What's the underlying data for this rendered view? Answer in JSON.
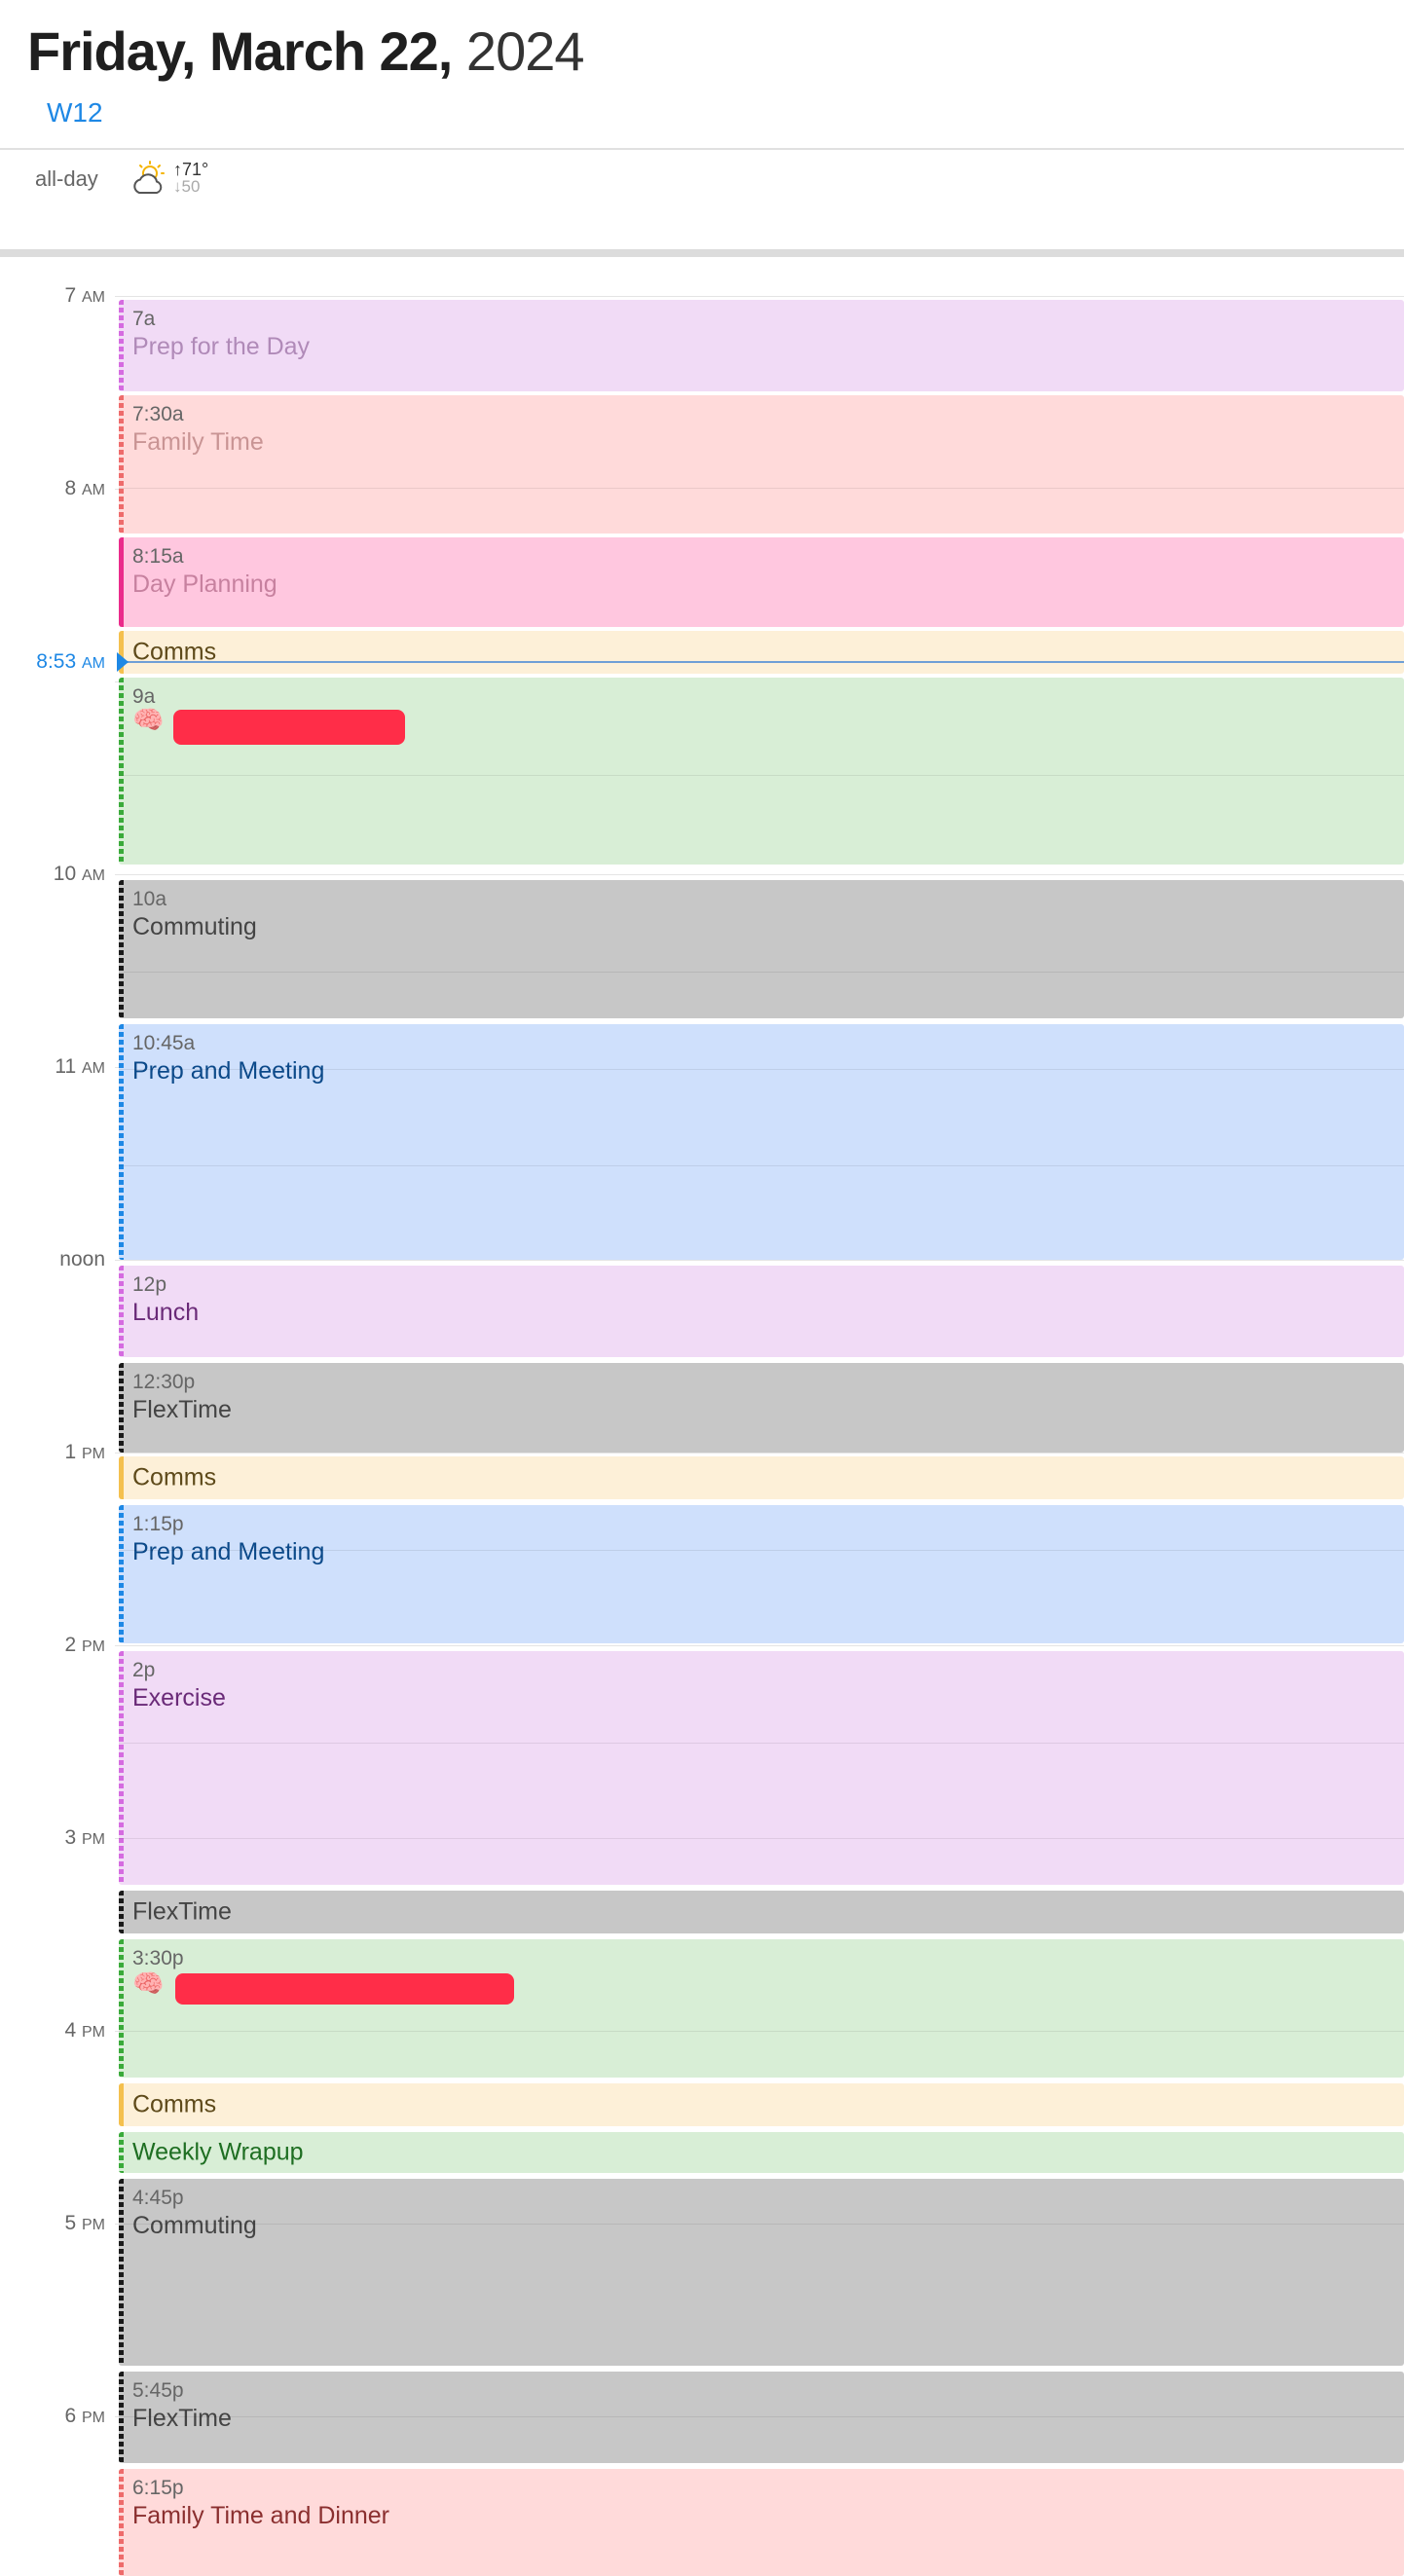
{
  "header": {
    "date": "Friday, March 22,",
    "year": "2024",
    "week": "W12"
  },
  "allday": {
    "label": "all-day",
    "weather_icon": "partly-cloudy-sun-icon",
    "high": "↑71°",
    "low": "↓50"
  },
  "hours": [
    {
      "label": "7",
      "ampm": "AM"
    },
    {
      "label": "8",
      "ampm": "AM"
    },
    {
      "label": "",
      "ampm": ""
    },
    {
      "label": "10",
      "ampm": "AM"
    },
    {
      "label": "11",
      "ampm": "AM"
    },
    {
      "label": "noon",
      "ampm": ""
    },
    {
      "label": "1",
      "ampm": "PM"
    },
    {
      "label": "2",
      "ampm": "PM"
    },
    {
      "label": "3",
      "ampm": "PM"
    },
    {
      "label": "4",
      "ampm": "PM"
    },
    {
      "label": "5",
      "ampm": "PM"
    },
    {
      "label": "6",
      "ampm": "PM"
    }
  ],
  "now": {
    "label": "8:53",
    "ampm": "AM"
  },
  "events": [
    {
      "time": "7a",
      "title": "Prep for the Day"
    },
    {
      "time": "7:30a",
      "title": "Family Time"
    },
    {
      "time": "8:15a",
      "title": "Day Planning"
    },
    {
      "time": "",
      "title": "Comms"
    },
    {
      "time": "9a",
      "title": "🧠"
    },
    {
      "time": "10a",
      "title": "Commuting"
    },
    {
      "time": "10:45a",
      "title": "Prep and Meeting"
    },
    {
      "time": "12p",
      "title": "Lunch"
    },
    {
      "time": "12:30p",
      "title": "FlexTime"
    },
    {
      "time": "",
      "title": "Comms"
    },
    {
      "time": "1:15p",
      "title": "Prep and Meeting"
    },
    {
      "time": "2p",
      "title": "Exercise"
    },
    {
      "time": "",
      "title": "FlexTime"
    },
    {
      "time": "3:30p",
      "title": "🧠"
    },
    {
      "time": "",
      "title": "Comms"
    },
    {
      "time": "",
      "title": "Weekly Wrapup"
    },
    {
      "time": "4:45p",
      "title": "Commuting"
    },
    {
      "time": "5:45p",
      "title": "FlexTime"
    },
    {
      "time": "6:15p",
      "title": "Family Time and Dinner"
    }
  ],
  "colors": {
    "accent": "#1e88e5",
    "purple": "#f1dbf6",
    "salmon": "#ffdada",
    "pink": "#ffc7df",
    "yellow": "#fdf0d8",
    "green": "#d8eed6",
    "gray": "#c7c7c7",
    "blue": "#cfe0fc",
    "redaction": "#ff2d48"
  }
}
